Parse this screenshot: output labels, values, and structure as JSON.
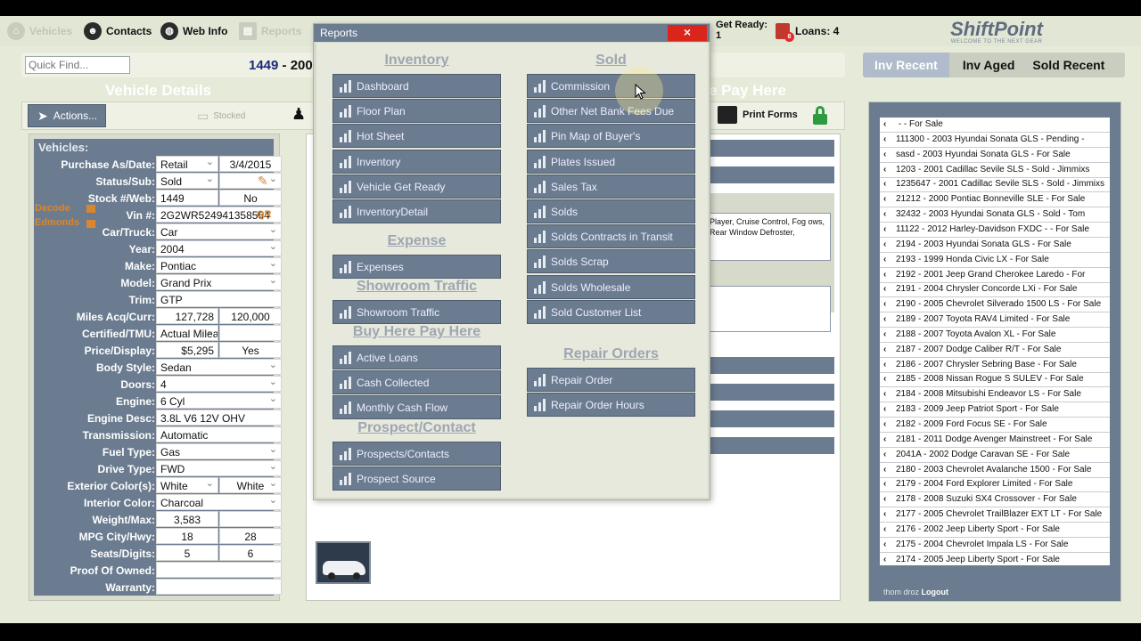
{
  "nav": {
    "items": [
      {
        "label": "Vehicles",
        "icon": "home-icon"
      },
      {
        "label": "Contacts",
        "icon": "contacts-icon"
      },
      {
        "label": "Web Info",
        "icon": "globe-icon"
      },
      {
        "label": "Reports",
        "icon": "reports-icon"
      }
    ],
    "get_ready_label": "Get Ready:",
    "get_ready_count": "1",
    "loans_label": "Loans: 4",
    "loans_badge": "8"
  },
  "logo": {
    "main": "ShiftPoint",
    "tagline": "WELCOME TO THE NEXT GEAR"
  },
  "quickfind": {
    "placeholder": "Quick Find..."
  },
  "vehicle_heading": {
    "stock": "1449",
    "rest": " - 200"
  },
  "tabs": [
    "Inv Recent",
    "Inv Aged",
    "Sold Recent"
  ],
  "section_titles": {
    "vehicle_details": "Vehicle Details",
    "bhph": "e Pay Here"
  },
  "actionbar": {
    "actions_label": "Actions...",
    "stocked": "Stocked",
    "print_forms": "Print Forms"
  },
  "vehicles": {
    "title": "Vehicles:",
    "decode": "Decode",
    "edmonds": "Edmonds",
    "qr": "QR",
    "rows": [
      {
        "label": "Purchase As/Date:",
        "v1": "Retail",
        "v2": "3/4/2015"
      },
      {
        "label": "Status/Sub:",
        "v1": "Sold",
        "v2": ""
      },
      {
        "label": "Stock #/Web:",
        "v1": "1449",
        "v2": "No"
      },
      {
        "label": "Vin #:",
        "v1": "2G2WR524941358564"
      },
      {
        "label": "Car/Truck:",
        "v1": "Car"
      },
      {
        "label": "Year:",
        "v1": "2004"
      },
      {
        "label": "Make:",
        "v1": "Pontiac"
      },
      {
        "label": "Model:",
        "v1": "Grand Prix"
      },
      {
        "label": "Trim:",
        "v1": "GTP"
      },
      {
        "label": "Miles Acq/Curr:",
        "v1": "127,728",
        "v2": "120,000"
      },
      {
        "label": "Certified/TMU:",
        "v1": "Actual Mileage",
        "v2": ""
      },
      {
        "label": "Price/Display:",
        "v1": "$5,295",
        "v2": "Yes"
      },
      {
        "label": "Body Style:",
        "v1": "Sedan"
      },
      {
        "label": "Doors:",
        "v1": "4"
      },
      {
        "label": "Engine:",
        "v1": "6 Cyl"
      },
      {
        "label": "Engine Desc:",
        "v1": "3.8L V6 12V OHV"
      },
      {
        "label": "Transmission:",
        "v1": "Automatic"
      },
      {
        "label": "Fuel Type:",
        "v1": "Gas"
      },
      {
        "label": "Drive Type:",
        "v1": "FWD"
      },
      {
        "label": "Exterior Color(s):",
        "v1": "White",
        "v2": "White"
      },
      {
        "label": "Interior Color:",
        "v1": "Charcoal"
      },
      {
        "label": "Weight/Max:",
        "v1": "3,583",
        "v2": ""
      },
      {
        "label": "MPG City/Hwy:",
        "v1": "18",
        "v2": "28"
      },
      {
        "label": "Seats/Digits:",
        "v1": "5",
        "v2": "6"
      },
      {
        "label": "Proof Of Owned:",
        "v1": ""
      },
      {
        "label": "Warranty:",
        "v1": ""
      }
    ]
  },
  "options_text": "Player, Cruise Control, Fog ows, Rear Window Defroster,",
  "reports_modal": {
    "title": "Reports",
    "close": "×",
    "inventory_head": "Inventory",
    "inventory": [
      "Dashboard",
      "Floor Plan",
      "Hot Sheet",
      "Inventory",
      "Vehicle Get Ready",
      "InventoryDetail"
    ],
    "expense_head": "Expense",
    "expense": [
      "Expenses"
    ],
    "showroom_head": "Showroom Traffic",
    "showroom": [
      "Showroom Traffic"
    ],
    "bhph_head": "Buy Here Pay Here",
    "bhph": [
      "Active Loans",
      "Cash Collected",
      "Monthly Cash Flow"
    ],
    "prospect_head": "Prospect/Contact",
    "prospect": [
      "Prospects/Contacts",
      "Prospect Source"
    ],
    "sold_head": "Sold",
    "sold": [
      "Commission",
      "Other Net Bank Fees Due",
      "Pin Map of Buyer's",
      "Plates Issued",
      "Sales Tax",
      "Solds",
      "Solds Contracts in Transit",
      "Solds Scrap",
      "Solds Wholesale",
      "Sold Customer List"
    ],
    "repair_head": "Repair Orders",
    "repair": [
      "Repair Order",
      "Repair Order Hours"
    ]
  },
  "sold_list": [
    " -  - For Sale",
    "111300 - 2003 Hyundai Sonata GLS - Pending -",
    "sasd - 2003 Hyundai Sonata GLS - For Sale",
    "1203 - 2001 Cadillac Sevile SLS - Sold - Jimmixs",
    "1235647 - 2001 Cadillac Sevile SLS - Sold - Jimmixs",
    "21212 - 2000 Pontiac Bonneville SLE - For Sale",
    "32432 - 2003 Hyundai Sonata GLS - Sold - Tom",
    "11122 - 2012 Harley-Davidson FXDC - - For Sale",
    "2194 - 2003 Hyundai Sonata GLS - For Sale",
    "2193 - 1999 Honda Civic LX - For Sale",
    "2192 - 2001 Jeep Grand Cherokee Laredo - For",
    "2191 - 2004 Chrysler Concorde LXi - For Sale",
    "2190 - 2005 Chevrolet Silverado 1500 LS - For Sale",
    "2189 - 2007 Toyota RAV4 Limited - For Sale",
    "2188 - 2007 Toyota Avalon XL - For Sale",
    "2187 - 2007 Dodge Caliber R/T - For Sale",
    "2186 - 2007 Chrysler Sebring Base - For Sale",
    "2185 - 2008 Nissan Rogue S SULEV - For Sale",
    "2184 - 2008 Mitsubishi Endeavor LS - For Sale",
    "2183 - 2009 Jeep Patriot Sport - For Sale",
    "2182 - 2009 Ford Focus SE - For Sale",
    "2181 - 2011 Dodge Avenger Mainstreet - For Sale",
    "2041A - 2002 Dodge Caravan SE - For Sale",
    "2180 - 2003 Chevrolet Avalanche 1500 - For Sale",
    "2179 - 2004 Ford Explorer Limited - For Sale",
    "2178 - 2008 Suzuki SX4 Crossover - For Sale",
    "2177 - 2005 Chevrolet TrailBlazer EXT LT - For Sale",
    "2176 - 2002 Jeep Liberty Sport - For Sale",
    "2175 - 2004 Chevrolet Impala LS - For Sale",
    "2174 - 2005 Jeep Liberty Sport - For Sale"
  ],
  "user": {
    "name": "thom droz",
    "logout": "Logout"
  },
  "colors": {
    "panel": "#6b7c90",
    "accent_blue": "#1a2a7c",
    "close_red": "#d9251c",
    "background": "#e6ead9"
  }
}
